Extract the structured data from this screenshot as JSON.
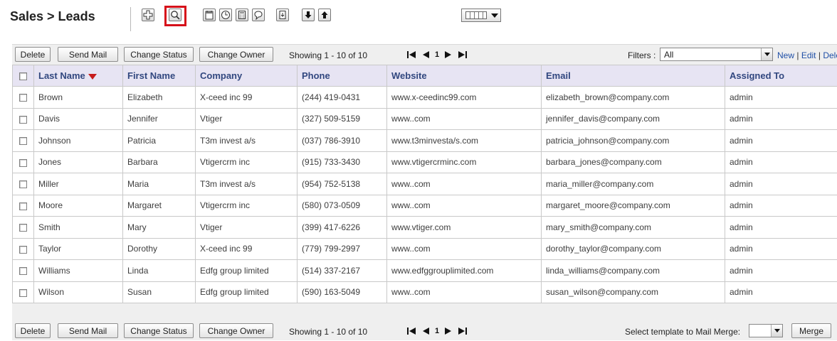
{
  "header": {
    "title": "Sales > Leads",
    "toolbar_icons": [
      "add-icon",
      "search-icon",
      "calendar-icon",
      "clock-icon",
      "calculator-icon",
      "chat-icon",
      "import-icon",
      "export-down-icon",
      "export-up-icon",
      "column-view-icon"
    ],
    "highlighted_icon": "search-icon"
  },
  "actions": {
    "delete": "Delete",
    "send_mail": "Send Mail",
    "change_status": "Change Status",
    "change_owner": "Change Owner",
    "showing": "Showing 1 - 10 of 10",
    "page": "1"
  },
  "filters": {
    "label": "Filters :",
    "selected": "All",
    "new": "New",
    "edit": "Edit",
    "delete": "Delete",
    "sep": "|"
  },
  "mail_merge": {
    "label": "Select template to Mail Merge:",
    "selected": "",
    "button": "Merge"
  },
  "table": {
    "columns": [
      "Last Name",
      "First Name",
      "Company",
      "Phone",
      "Website",
      "Email",
      "Assigned To"
    ],
    "sorted_column": "Last Name",
    "rows": [
      {
        "last": "Brown",
        "first": "Elizabeth",
        "company": "X-ceed inc 99",
        "phone": "(244) 419-0431",
        "website": "www.x-ceedinc99.com",
        "email": "elizabeth_brown@company.com",
        "assigned": "admin"
      },
      {
        "last": "Davis",
        "first": "Jennifer",
        "company": "Vtiger",
        "phone": "(327) 509-5159",
        "website": "www..com",
        "email": "jennifer_davis@company.com",
        "assigned": "admin"
      },
      {
        "last": "Johnson",
        "first": "Patricia",
        "company": "T3m invest a/s",
        "phone": "(037) 786-3910",
        "website": "www.t3minvesta/s.com",
        "email": "patricia_johnson@company.com",
        "assigned": "admin"
      },
      {
        "last": "Jones",
        "first": "Barbara",
        "company": "Vtigercrm inc",
        "phone": "(915) 733-3430",
        "website": "www.vtigercrminc.com",
        "email": "barbara_jones@company.com",
        "assigned": "admin"
      },
      {
        "last": "Miller",
        "first": "Maria",
        "company": "T3m invest a/s",
        "phone": "(954) 752-5138",
        "website": "www..com",
        "email": "maria_miller@company.com",
        "assigned": "admin"
      },
      {
        "last": "Moore",
        "first": "Margaret",
        "company": "Vtigercrm inc",
        "phone": "(580) 073-0509",
        "website": "www..com",
        "email": "margaret_moore@company.com",
        "assigned": "admin"
      },
      {
        "last": "Smith",
        "first": "Mary",
        "company": "Vtiger",
        "phone": "(399) 417-6226",
        "website": "www.vtiger.com",
        "email": "mary_smith@company.com",
        "assigned": "admin"
      },
      {
        "last": "Taylor",
        "first": "Dorothy",
        "company": "X-ceed inc 99",
        "phone": "(779) 799-2997",
        "website": "www..com",
        "email": "dorothy_taylor@company.com",
        "assigned": "admin"
      },
      {
        "last": "Williams",
        "first": "Linda",
        "company": "Edfg group limited",
        "phone": "(514) 337-2167",
        "website": "www.edfggrouplimited.com",
        "email": "linda_williams@company.com",
        "assigned": "admin"
      },
      {
        "last": "Wilson",
        "first": "Susan",
        "company": "Edfg group limited",
        "phone": "(590) 163-5049",
        "website": "www..com",
        "email": "susan_wilson@company.com",
        "assigned": "admin"
      }
    ]
  }
}
